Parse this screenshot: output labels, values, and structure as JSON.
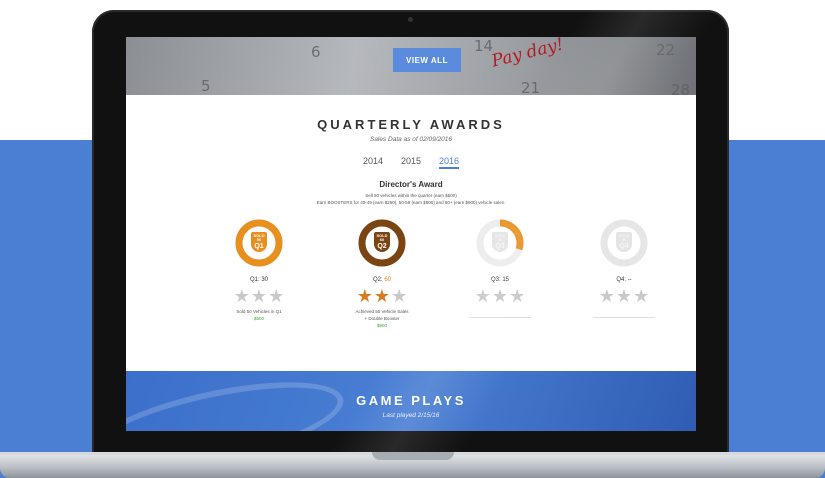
{
  "hero": {
    "view_all_label": "VIEW ALL",
    "calendar_numbers": [
      "6",
      "14",
      "22",
      "5",
      "21",
      "28"
    ],
    "scribble": "Pay day!"
  },
  "quarterly": {
    "title": "QUARTERLY AWARDS",
    "subtitle": "Sales Data as of 02/09/2016",
    "years": [
      "2014",
      "2015",
      "2016"
    ],
    "selected_year": "2016"
  },
  "director": {
    "title": "Director's Award",
    "line1": "Sell 50 vehicles within the quarter (earn $500)",
    "line2": "Earn BOOSTERS for 40-49 (earn $250), 50-59 (earn $500) and 60+ (earn $900) vehicle sales."
  },
  "quarters": [
    {
      "label": "Q1: 30",
      "badge_top": "SOLD 50",
      "badge_q": "Q1",
      "color": "#e8901f",
      "progress": 1.0,
      "stars_gold": 0,
      "note1": "Sold 50 Vehicles in Q1",
      "note2": "",
      "amount": "$500"
    },
    {
      "label_prefix": "Q2: ",
      "label_value": "60",
      "badge_top": "SOLD 60",
      "badge_q": "Q2",
      "color": "#7a4512",
      "progress": 1.0,
      "stars_gold": 2,
      "note1": "Achieved 50 Vehicle Sales",
      "note2": "+ Double Booster",
      "amount": "$900"
    },
    {
      "label": "Q3: 15",
      "badge_top": "SOLD 50",
      "badge_q": "Q3",
      "color": "#e8901f",
      "progress": 0.3,
      "stars_gold": 0,
      "note1": "",
      "note2": "",
      "amount": ""
    },
    {
      "label": "Q4: --",
      "badge_top": "SOLD 50",
      "badge_q": "Q4",
      "color": "#d8d8d8",
      "progress": 0.0,
      "stars_gold": 0,
      "note1": "",
      "note2": "",
      "amount": ""
    }
  ],
  "game_plays": {
    "title": "GAME PLAYS",
    "subtitle": "Last played 2/15/16"
  },
  "colors": {
    "accent": "#4a7fd4",
    "orange": "#e8901f",
    "brown": "#7a4512",
    "green": "#3da63d"
  }
}
